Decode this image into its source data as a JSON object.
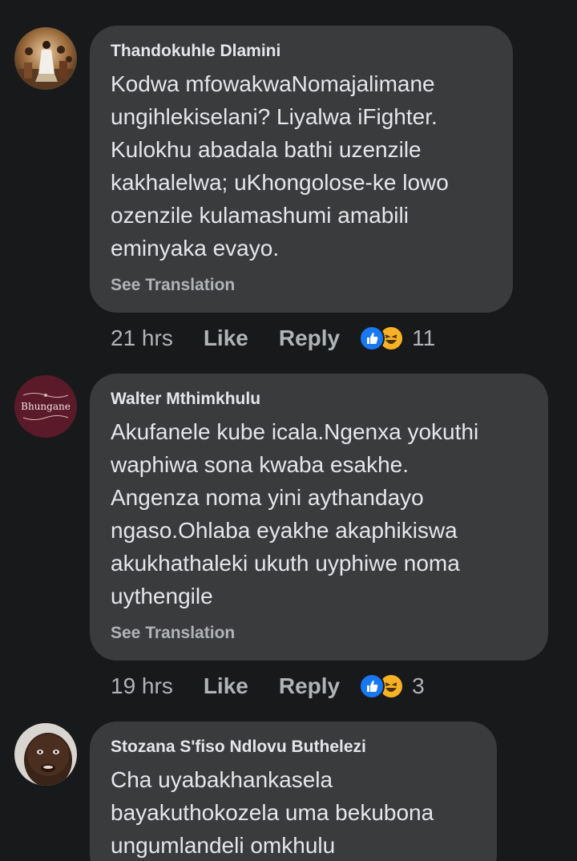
{
  "comments": [
    {
      "author": "Thandokuhle Dlamini",
      "text": "Kodwa mfowakwaNomajalimane\nungihlekiselani? Liyalwa iFighter.\nKulokhu abadala bathi uzenzile\nkakhalelwa; uKhongolose-ke lowo\nozenzile kulamashumi amabili\neminyaka evayo.",
      "see_translation": "See Translation",
      "time": "21 hrs",
      "like": "Like",
      "reply": "Reply",
      "reaction_count": "11",
      "reactions": [
        "like-icon",
        "haha-icon"
      ]
    },
    {
      "author": "Walter Mthimkhulu",
      "avatar_text": "Bhungane",
      "text": "Akufanele kube icala.Ngenxa yokuthi\nwaphiwa sona kwaba esakhe.\nAngenza noma yini aythandayo\nngaso.Ohlaba eyakhe akaphikiswa\nakukhathaleki ukuth uyphiwe noma\nuythengile",
      "see_translation": "See Translation",
      "time": "19 hrs",
      "like": "Like",
      "reply": "Reply",
      "reaction_count": "3",
      "reactions": [
        "like-icon",
        "haha-icon"
      ]
    },
    {
      "author": "Stozana S'fiso Ndlovu Buthelezi",
      "text": "Cha uyabakhankasela\nbayakuthokozela uma bekubona\nungumlandeli omkhulu"
    }
  ],
  "colors": {
    "background": "#18191a",
    "bubble": "#3a3b3c",
    "text": "#e4e6eb",
    "secondary": "#b0b3b8",
    "like_blue": "#1877f2",
    "haha_yellow": "#f7b125"
  }
}
